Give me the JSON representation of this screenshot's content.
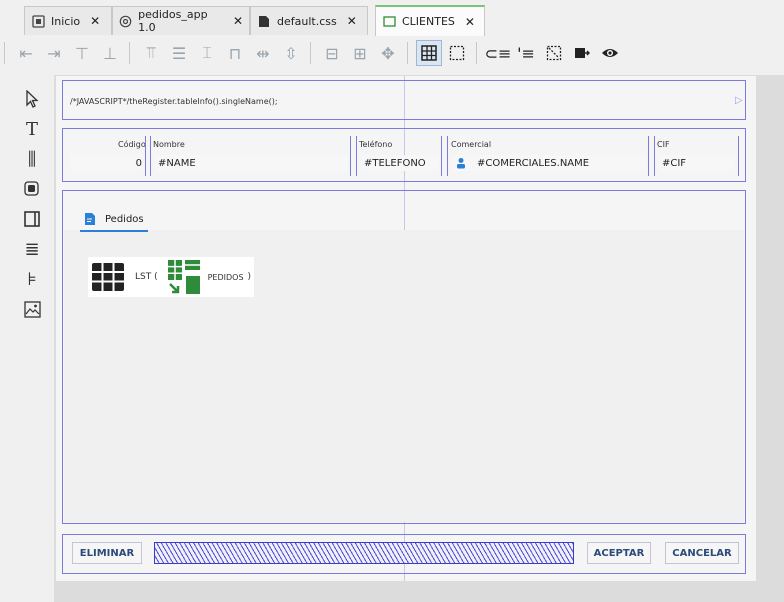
{
  "tabs": [
    {
      "label": "Inicio",
      "icon": "home-icon",
      "active": false
    },
    {
      "label": "pedidos_app 1.0",
      "icon": "settings-icon",
      "active": false
    },
    {
      "label": "default.css",
      "icon": "file-icon",
      "active": false
    },
    {
      "label": "CLIENTES",
      "icon": "window-icon",
      "active": true
    }
  ],
  "code_band": {
    "script": "/*JAVASCRIPT*/theRegister.tableInfo().singleName();"
  },
  "header_fields": {
    "codigo_label": "Código",
    "codigo_value": "0",
    "nombre_label": "Nombre",
    "nombre_value": "#NAME",
    "telefono_label": "Teléfono",
    "telefono_value": "#TELEFONO",
    "comercial_label": "Comercial",
    "comercial_value": "#COMERCIALES.NAME",
    "cif_label": "CIF",
    "cif_value": "#CIF"
  },
  "subtab": {
    "label": "Pedidos"
  },
  "list_widget": {
    "prefix": "LST (",
    "table": "PEDIDOS",
    "suffix": ")"
  },
  "footer": {
    "delete_label": "ELIMINAR",
    "accept_label": "ACEPTAR",
    "cancel_label": "CANCELAR"
  }
}
